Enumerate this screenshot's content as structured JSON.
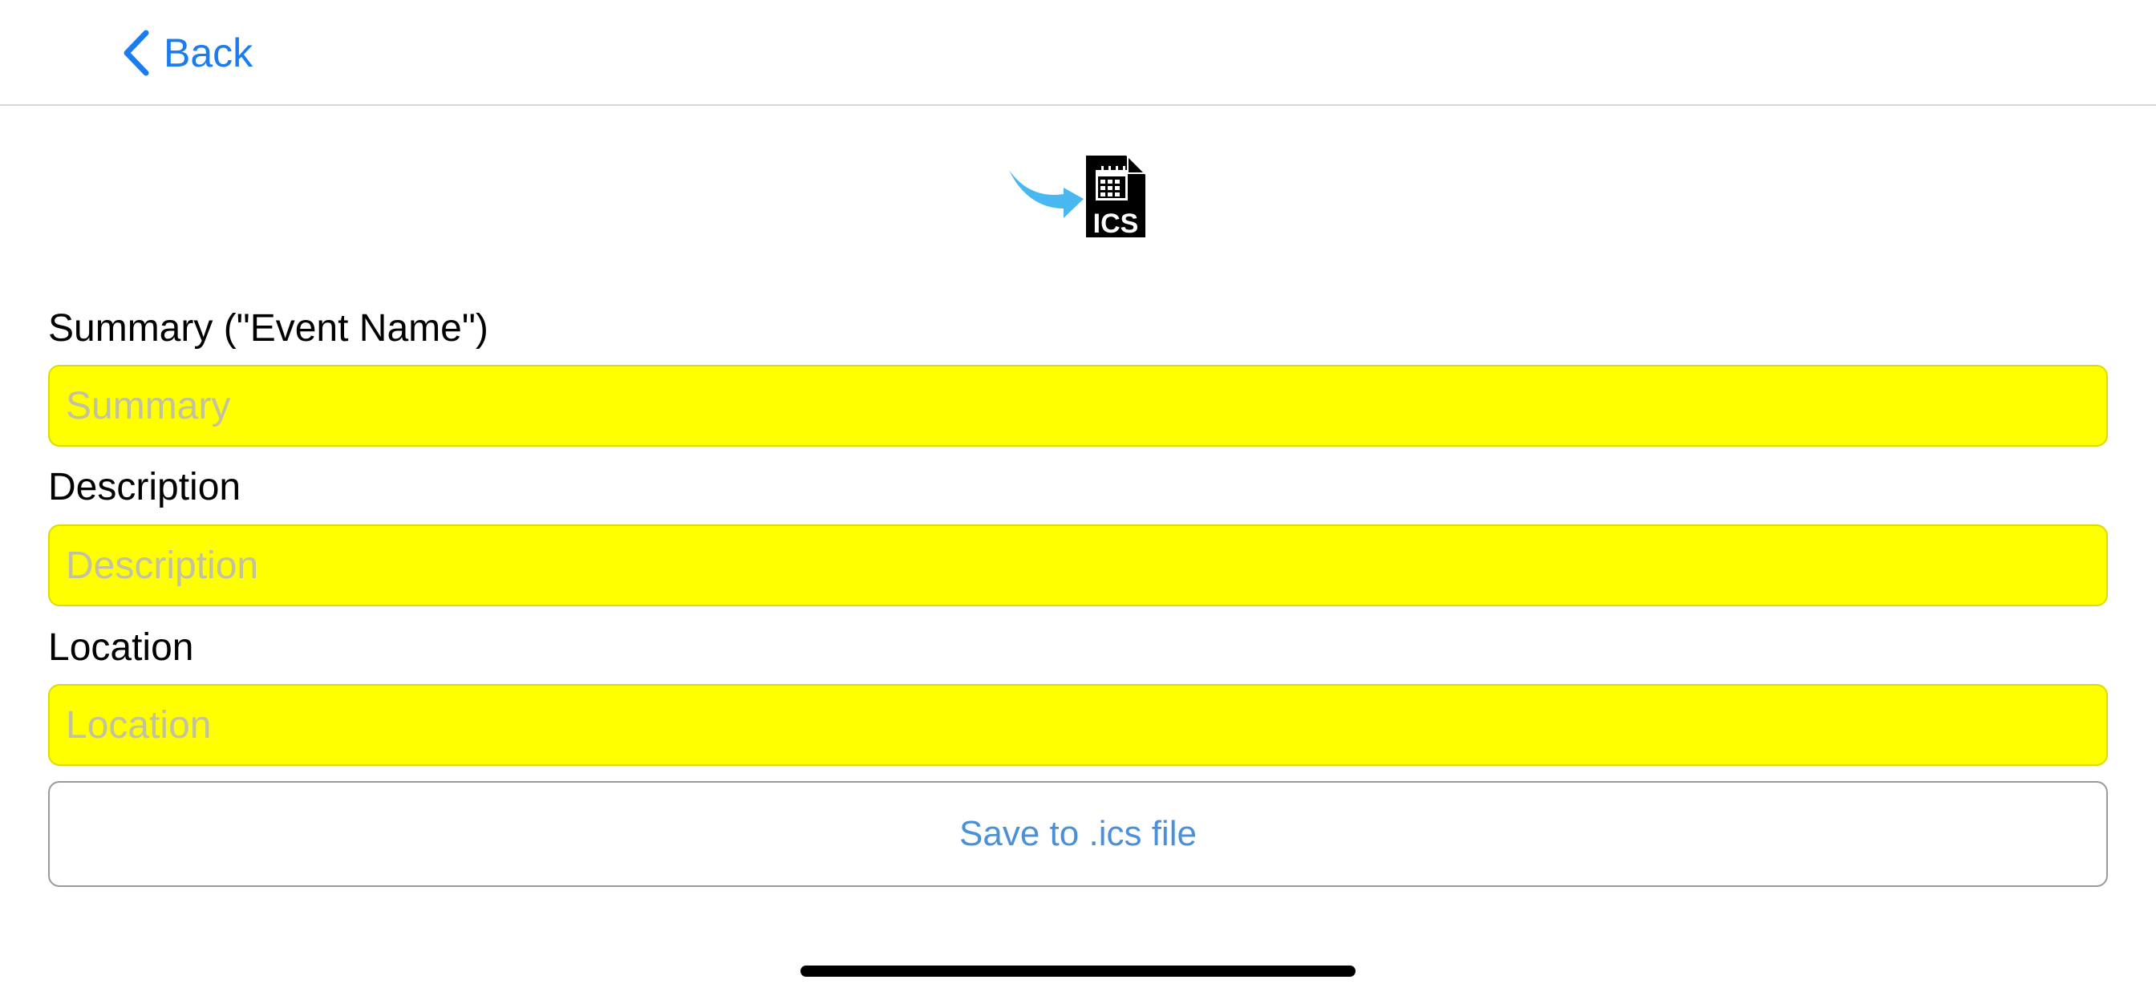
{
  "nav": {
    "back_label": "Back"
  },
  "logo": {
    "icon": "ics-file-icon",
    "text": "ICS",
    "arrow_color": "#4ab8f0"
  },
  "form": {
    "summary_label": "Summary (\"Event Name\")",
    "summary_placeholder": "Summary",
    "summary_value": "",
    "description_label": "Description",
    "description_placeholder": "Description",
    "description_value": "",
    "location_label": "Location",
    "location_placeholder": "Location",
    "location_value": "",
    "field_color": "#ffff00"
  },
  "actions": {
    "save_label": "Save to .ics file"
  },
  "colors": {
    "accent": "#1b7cf0",
    "button_text": "#4a90d9"
  }
}
